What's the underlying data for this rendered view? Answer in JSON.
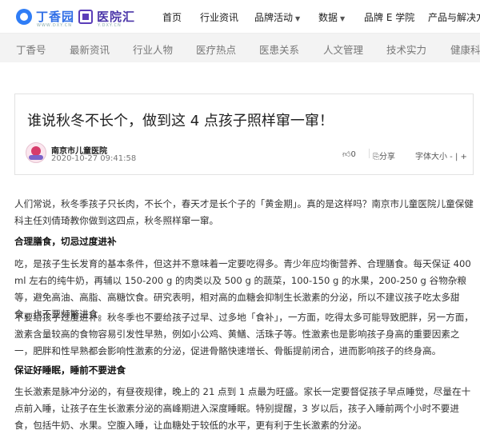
{
  "brand": {
    "logo1_text": "丁香园",
    "logo1_sub": "WWW.DXY.CN",
    "logo2_text": "医院汇",
    "logo2_sub": "Y.DXY.CN"
  },
  "nav": {
    "home": "首页",
    "news": "行业资讯",
    "events": "品牌活动",
    "data": "数据",
    "eschool": "品牌 E 学院",
    "products": "产品与解决方"
  },
  "subnav": [
    "丁香号",
    "最新资讯",
    "行业人物",
    "医疗热点",
    "医患关系",
    "人文管理",
    "技术实力",
    "健康科"
  ],
  "article": {
    "title": "谁说秋冬不长个，做到这 4 点孩子照样窜一窜！",
    "author": "南京市儿童医院",
    "date": "2020-10-27 09:41:58",
    "likes": "0",
    "share": "分享",
    "font_size": "字体大小 -",
    "font_sep": "|",
    "font_plus": "+",
    "p1": "人们常说，秋冬季孩子只长肉，不长个，春天才是长个子的「黄金期」。真的是这样吗？南京市儿童医院儿童保健科主任刘倩琦教你做到这四点，秋冬照样窜一窜。",
    "h1": "合理膳食，切忌过度进补",
    "p2": "吃，是孩子生长发育的基本条件，但这并不意味着一定要吃得多。青少年应均衡营养、合理膳食。每天保证 400 ml 左右的纯牛奶，再辅以 150-200 g 的肉类以及 500 g 的蔬菜，100-150 g 的水果，200-250 g 谷物杂粮等，避免高油、高脂、高糖饮食。研究表明，相对高的血糖会抑制生长激素的分泌，所以不建议孩子吃太多甜食，也不要频繁进食。",
    "p3": "不要给孩子过度进补。秋冬季也不要给孩子过早、过多地「食补」，一方面，吃得太多可能导致肥胖，另一方面，激素含量较高的食物容易引发性早熟，例如小公鸡、黄鳝、活珠子等。性激素也是影响孩子身高的重要因素之一，肥胖和性早熟都会影响性激素的分泌，促进骨骼快速增长、骨骺提前闭合，进而影响孩子的终身高。",
    "h2": "保证好睡眠，睡前不要进食",
    "p4": "生长激素是脉冲分泌的，有昼夜规律，晚上的 21 点到 1 点最为旺盛。家长一定要督促孩子早点睡觉，尽量在十点前入睡，让孩子在生长激素分泌的高峰期进入深度睡眠。特别提醒，3 岁以后，孩子入睡前两个小时不要进食，包括牛奶、水果。空腹入睡，让血糖处于较低的水平，更有利于生长激素的分泌。"
  }
}
